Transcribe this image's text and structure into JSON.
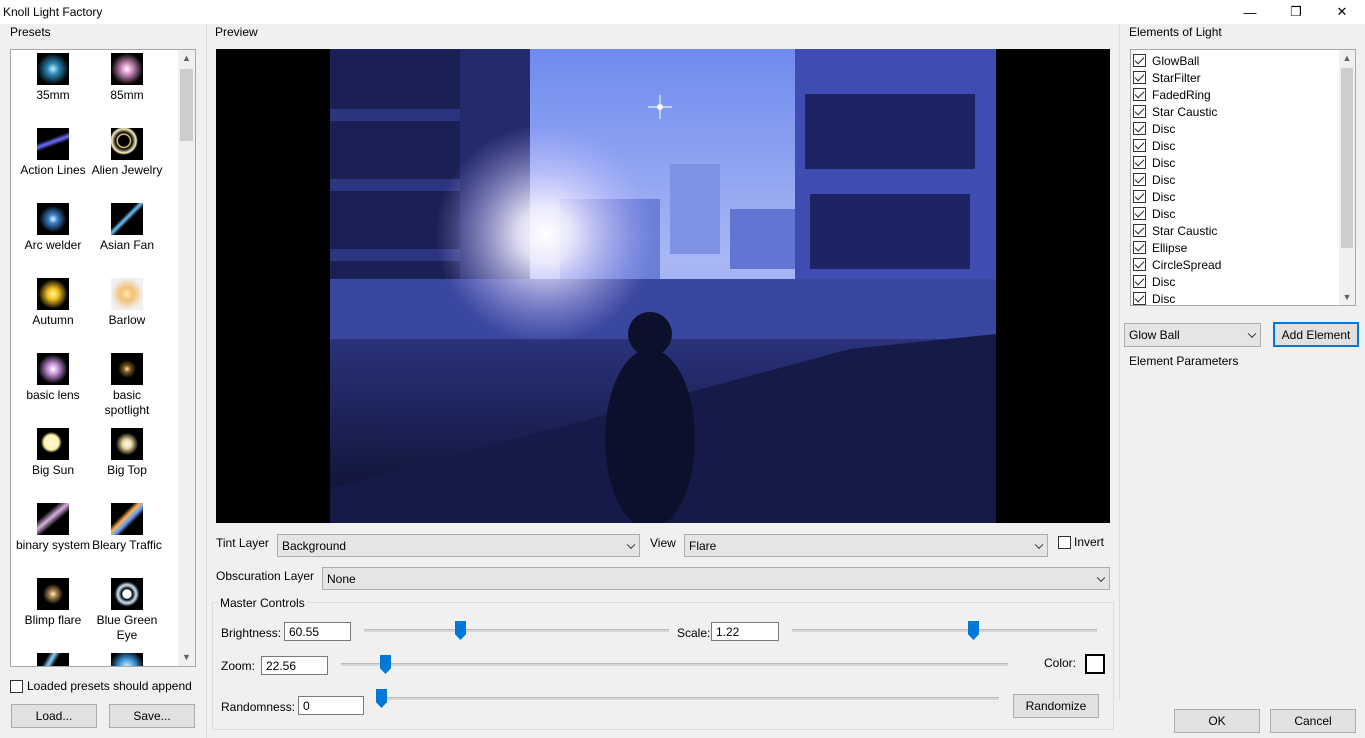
{
  "window": {
    "title": "Knoll Light Factory",
    "minimize": "—",
    "restore": "❐",
    "close": "✕"
  },
  "presets": {
    "heading": "Presets",
    "items": [
      {
        "label": "35mm"
      },
      {
        "label": "85mm"
      },
      {
        "label": "Action Lines"
      },
      {
        "label": "Alien Jewelry"
      },
      {
        "label": "Arc welder"
      },
      {
        "label": "Asian Fan"
      },
      {
        "label": "Autumn"
      },
      {
        "label": "Barlow"
      },
      {
        "label": "basic lens"
      },
      {
        "label": "basic spotlight"
      },
      {
        "label": "Big Sun"
      },
      {
        "label": "Big Top"
      },
      {
        "label": "binary system"
      },
      {
        "label": "Bleary Traffic"
      },
      {
        "label": "Blimp flare"
      },
      {
        "label": "Blue Green Eye"
      }
    ],
    "append_label": "Loaded presets should append",
    "load_label": "Load...",
    "save_label": "Save..."
  },
  "preview": {
    "heading": "Preview",
    "tint_layer_label": "Tint Layer",
    "tint_layer_value": "Background",
    "view_label": "View",
    "view_value": "Flare",
    "invert_label": "Invert",
    "obscuration_label": "Obscuration Layer",
    "obscuration_value": "None"
  },
  "master": {
    "heading": "Master Controls",
    "brightness_label": "Brightness:",
    "brightness_value": "60.55",
    "brightness_level": 0.31,
    "scale_label": "Scale:",
    "scale_value": "1.22",
    "scale_level": 0.6,
    "zoom_label": "Zoom:",
    "zoom_value": "22.56",
    "zoom_level": 0.06,
    "color_label": "Color:",
    "randomness_label": "Randomness:",
    "randomness_value": "0",
    "randomness_level": 0.0,
    "randomize_label": "Randomize"
  },
  "elements": {
    "heading": "Elements of Light",
    "items": [
      {
        "label": "GlowBall",
        "checked": true
      },
      {
        "label": "StarFilter",
        "checked": true
      },
      {
        "label": "FadedRing",
        "checked": true
      },
      {
        "label": "Star Caustic",
        "checked": true
      },
      {
        "label": "Disc",
        "checked": true
      },
      {
        "label": "Disc",
        "checked": true
      },
      {
        "label": "Disc",
        "checked": true
      },
      {
        "label": "Disc",
        "checked": true
      },
      {
        "label": "Disc",
        "checked": true
      },
      {
        "label": "Disc",
        "checked": true
      },
      {
        "label": "Star Caustic",
        "checked": true
      },
      {
        "label": "Ellipse",
        "checked": true
      },
      {
        "label": "CircleSpread",
        "checked": true
      },
      {
        "label": "Disc",
        "checked": true
      },
      {
        "label": "Disc",
        "checked": true
      }
    ],
    "type_select_value": "Glow Ball",
    "add_label": "Add Element",
    "params_heading": "Element Parameters"
  },
  "footer": {
    "ok_label": "OK",
    "cancel_label": "Cancel"
  },
  "colors": {
    "accent": "#0078d7",
    "sky": "#8fa6ee",
    "night": "#12163a"
  }
}
